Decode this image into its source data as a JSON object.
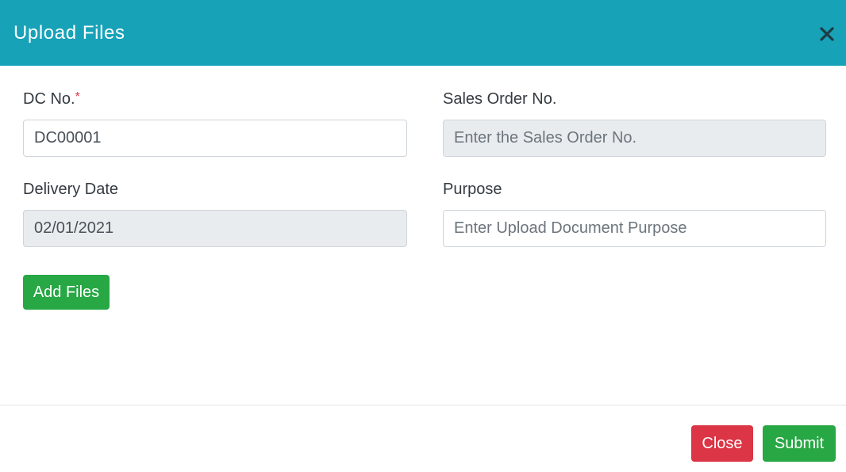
{
  "header": {
    "title": "Upload Files",
    "close_icon": "close-icon",
    "color": "#17a2b8"
  },
  "form": {
    "dc_no": {
      "label": "DC No.",
      "required_marker": "*",
      "value": "DC00001"
    },
    "sales_order_no": {
      "label": "Sales Order No.",
      "placeholder": "Enter the Sales Order No."
    },
    "delivery_date": {
      "label": "Delivery Date",
      "value": "02/01/2021"
    },
    "purpose": {
      "label": "Purpose",
      "placeholder": "Enter Upload Document Purpose"
    },
    "add_files_label": "Add Files"
  },
  "footer": {
    "close_label": "Close",
    "submit_label": "Submit"
  },
  "colors": {
    "success": "#28a745",
    "danger": "#dc3545",
    "readonly_bg": "#e9ecef"
  }
}
